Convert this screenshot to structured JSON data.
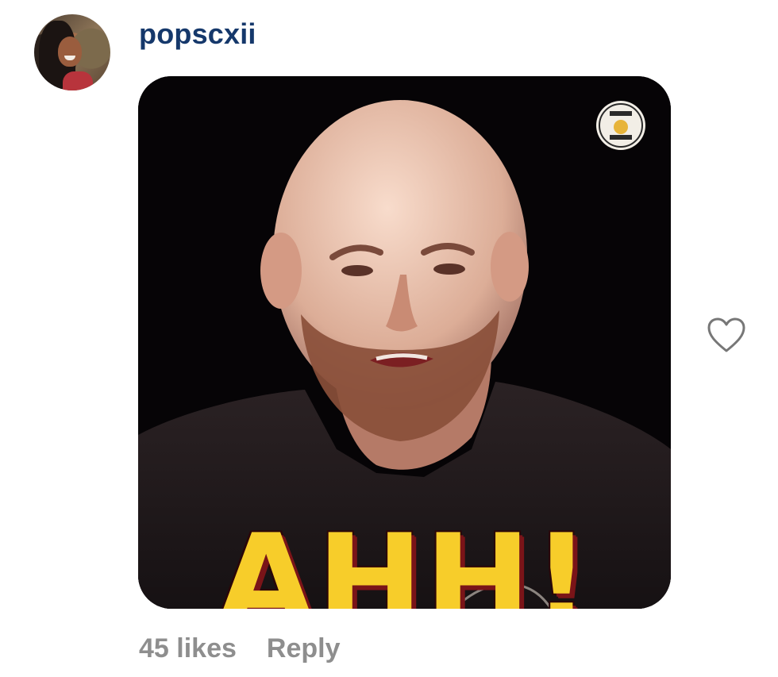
{
  "comment": {
    "username": "popscxii",
    "media": {
      "caption_text": "AHH!",
      "kind": "gif"
    },
    "likes_label": "45 likes",
    "reply_label": "Reply",
    "like_icon": "heart-outline-icon"
  },
  "colors": {
    "username": "#15386b",
    "meta_text": "#8e8e8e",
    "caption_yellow": "#f7cd2a",
    "caption_shadow": "#7a1418"
  }
}
